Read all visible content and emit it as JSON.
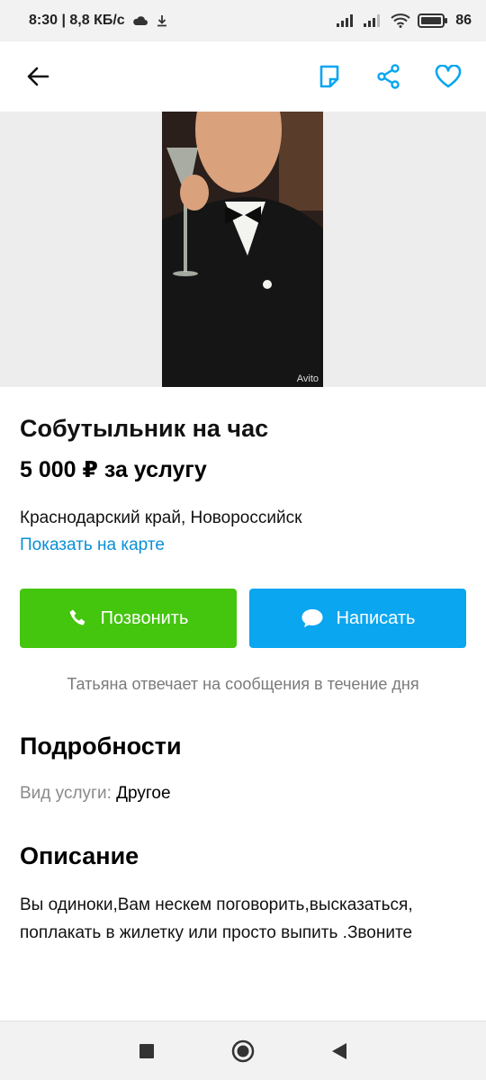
{
  "status_bar": {
    "time_speed": "8:30 | 8,8 КБ/с",
    "battery": "86"
  },
  "listing": {
    "title": "Собутыльник на час",
    "price": "5 000 ₽ за услугу",
    "location": "Краснодарский край, Новороссийск",
    "map_link": "Показать на карте",
    "photo_watermark": "Avito"
  },
  "actions": {
    "call_label": "Позвонить",
    "message_label": "Написать"
  },
  "reply_note": "Татьяна отвечает на сообщения в течение дня",
  "details": {
    "heading": "Подробности",
    "service_key": "Вид услуги:",
    "service_value": "Другое"
  },
  "description": {
    "heading": "Описание",
    "text": "Вы одиноки,Вам нескем поговорить,высказаться, поплакать в жилетку или просто выпить .Звоните"
  },
  "colors": {
    "accent_blue": "#0aa6f0",
    "call_green": "#44c50e",
    "link_blue": "#0a8fd6"
  },
  "icons": [
    "back-arrow-icon",
    "note-icon",
    "share-icon",
    "heart-icon",
    "phone-icon",
    "chat-bubble-icon",
    "nav-square-icon",
    "nav-circle-icon",
    "nav-back-icon"
  ]
}
